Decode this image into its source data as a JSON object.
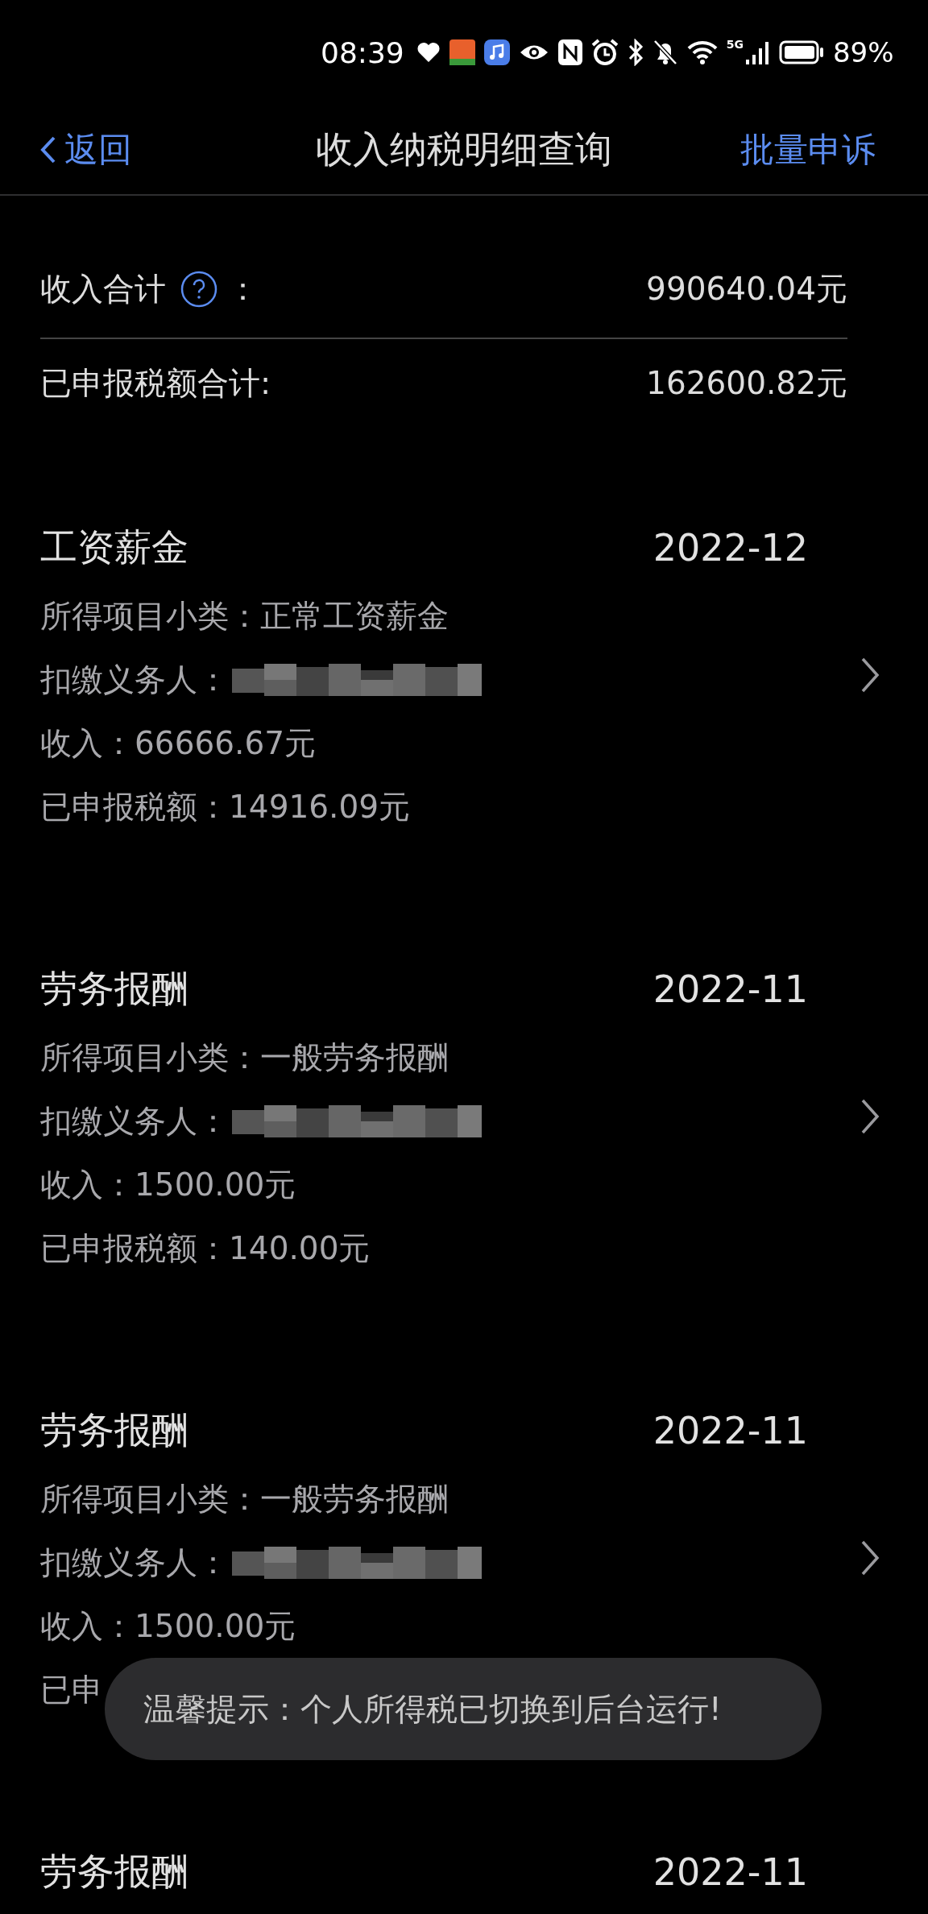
{
  "status_bar": {
    "time": "08:39",
    "network": "5G",
    "battery": "89%"
  },
  "nav_bar": {
    "back": "返回",
    "title": "收入纳税明细查询",
    "action": "批量申诉"
  },
  "summary": [
    {
      "label": "收入合计",
      "help": true,
      "colon": "：",
      "value": "990640.04元"
    },
    {
      "label": "已申报税额合计:",
      "help": false,
      "value": "162600.82元"
    }
  ],
  "records": [
    {
      "category": "工资薪金",
      "date": "2022-12",
      "subcategory_label": "所得项目小类：",
      "subcategory": "正常工资薪金",
      "payer_label": "扣缴义务人：",
      "income_label": "收入：",
      "income": "66666.67元",
      "tax_label": "已申报税额：",
      "tax": "14916.09元"
    },
    {
      "category": "劳务报酬",
      "date": "2022-11",
      "subcategory_label": "所得项目小类：",
      "subcategory": "一般劳务报酬",
      "payer_label": "扣缴义务人：",
      "income_label": "收入：",
      "income": "1500.00元",
      "tax_label": "已申报税额：",
      "tax": "140.00元"
    },
    {
      "category": "劳务报酬",
      "date": "2022-11",
      "subcategory_label": "所得项目小类：",
      "subcategory": "一般劳务报酬",
      "payer_label": "扣缴义务人：",
      "income_label": "收入：",
      "income": "1500.00元",
      "tax_label": "已申"
    },
    {
      "category": "劳务报酬",
      "date": "2022-11"
    }
  ],
  "toast": "温馨提示：个人所得税已切换到后台运行!"
}
